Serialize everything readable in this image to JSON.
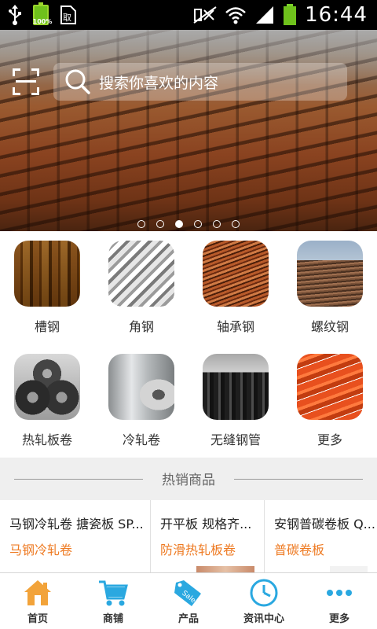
{
  "status_bar": {
    "time": "16:44",
    "battery_small_label": "100%",
    "icons": [
      "usb-icon",
      "battery-icon",
      "sim-icon",
      "mute-icon",
      "wifi-icon",
      "signal-icon",
      "battery-icon"
    ]
  },
  "header": {
    "search_placeholder": "搜索你喜欢的内容",
    "scan_icon": "scan-icon",
    "search_icon": "search-icon"
  },
  "carousel": {
    "slide_count": 6,
    "active_index": 2
  },
  "categories": [
    {
      "label": "槽钢",
      "image": "channel-steel"
    },
    {
      "label": "角钢",
      "image": "angle-steel"
    },
    {
      "label": "轴承钢",
      "image": "bearing-steel"
    },
    {
      "label": "螺纹钢",
      "image": "rebar"
    },
    {
      "label": "热轧板卷",
      "image": "hot-rolled-coil"
    },
    {
      "label": "冷轧卷",
      "image": "cold-rolled-coil"
    },
    {
      "label": "无缝钢管",
      "image": "seamless-pipe"
    },
    {
      "label": "更多",
      "image": "more"
    }
  ],
  "hot_section": {
    "title": "热销商品",
    "products": [
      {
        "name": "马钢冷轧卷 搪瓷板 SP...",
        "tag": "马钢冷轧卷"
      },
      {
        "name": "开平板 规格齐...",
        "tag": "防滑热轧板卷"
      },
      {
        "name": "安钢普碳卷板 Q...",
        "tag": "普碳卷板"
      }
    ]
  },
  "tab_bar": {
    "tabs": [
      {
        "label": "首页",
        "icon": "home-icon"
      },
      {
        "label": "商铺",
        "icon": "cart-icon"
      },
      {
        "label": "产品",
        "icon": "sale-tag-icon"
      },
      {
        "label": "资讯中心",
        "icon": "clock-icon"
      },
      {
        "label": "更多",
        "icon": "more-dots-icon"
      }
    ]
  },
  "colors": {
    "accent_orange": "#ee7a22",
    "tab_icon_blue": "#2aa8e0",
    "home_icon_orange": "#f2a33a",
    "status_battery_green": "#6fc11c"
  }
}
